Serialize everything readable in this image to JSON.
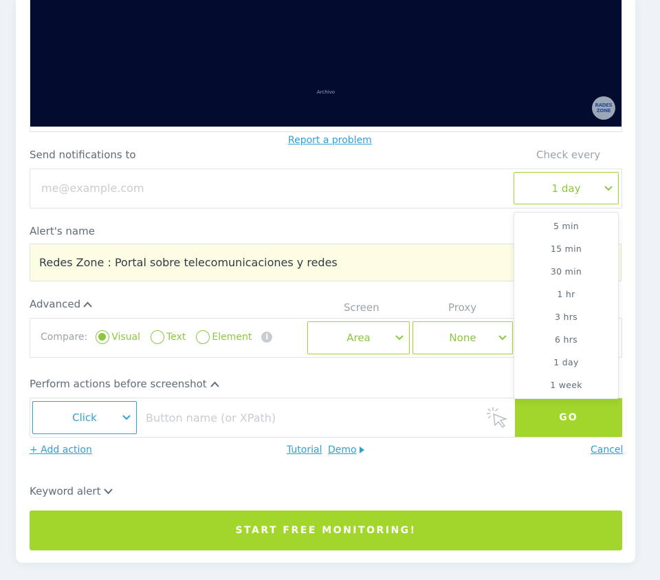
{
  "preview": {
    "caption": "Archivo",
    "logo_text": "REDES ZONE"
  },
  "report_link": "Report a problem",
  "notifications": {
    "label": "Send notifications to",
    "email_placeholder": "me@example.com",
    "check_every_label": "Check every",
    "check_every_value": "1 day"
  },
  "frequency_options": [
    "5 min",
    "15 min",
    "30 min",
    "1 hr",
    "3 hrs",
    "6 hrs",
    "1 day",
    "1 week"
  ],
  "alert": {
    "label": "Alert's name",
    "value": "Redes Zone : Portal sobre telecomunicaciones y redes"
  },
  "advanced": {
    "label": "Advanced",
    "compare_label": "Compare:",
    "options": [
      {
        "label": "Visual",
        "selected": true
      },
      {
        "label": "Text",
        "selected": false
      },
      {
        "label": "Element",
        "selected": false
      }
    ],
    "screen_label": "Screen",
    "screen_value": "Area",
    "proxy_label": "Proxy",
    "proxy_value": "None"
  },
  "actions": {
    "label": "Perform actions before screenshot",
    "action_type": "Click",
    "input_placeholder": "Button name (or XPath)",
    "go_label": "GO",
    "add_action": "+ Add action",
    "tutorial": "Tutorial",
    "demo": "Demo",
    "cancel": "Cancel"
  },
  "keyword_alert": {
    "label": "Keyword alert"
  },
  "start_button": "START FREE MONITORING!",
  "colors": {
    "accent_green": "#a2d62c",
    "text_green": "#8cc63f",
    "link_blue": "#2ea0d4",
    "preview_bg": "#030b2e",
    "alert_bg": "#fdfde4"
  }
}
